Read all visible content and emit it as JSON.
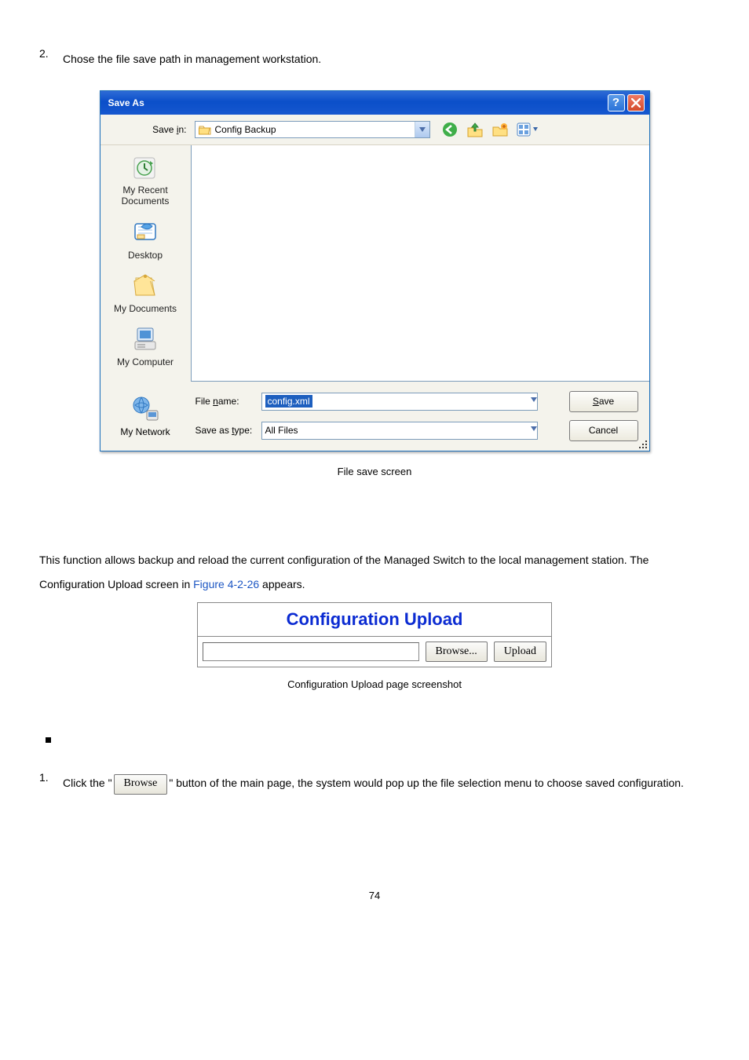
{
  "step2": {
    "num": "2.",
    "text": "Chose the file save path in management workstation."
  },
  "saveas": {
    "title": "Save As",
    "save_in_label": "Save in:",
    "save_in_value": "Config Backup",
    "places": {
      "recent": "My Recent Documents",
      "desktop": "Desktop",
      "mydocs": "My Documents",
      "mycomp": "My Computer",
      "mynet": "My Network"
    },
    "filename_label": "File name:",
    "filename_value": "config.xml",
    "type_label": "Save as type:",
    "type_value": "All Files",
    "save_btn": "Save",
    "cancel_btn": "Cancel"
  },
  "caption1": "File save screen",
  "para1_a": "This function allows backup and reload the current configuration of the Managed Switch to the local management station. The Configuration Upload screen in ",
  "para1_link": "Figure 4-2-26",
  "para1_b": " appears.",
  "cfg": {
    "title": "Configuration Upload",
    "browse": "Browse...",
    "upload": "Upload"
  },
  "caption2": "Configuration Upload page screenshot",
  "step1": {
    "num": "1.",
    "a": "Click the \"",
    "btn": "Browse",
    "b": "\" button of the main page, the system would pop up the file selection menu to choose saved configuration."
  },
  "pagenum": "74"
}
